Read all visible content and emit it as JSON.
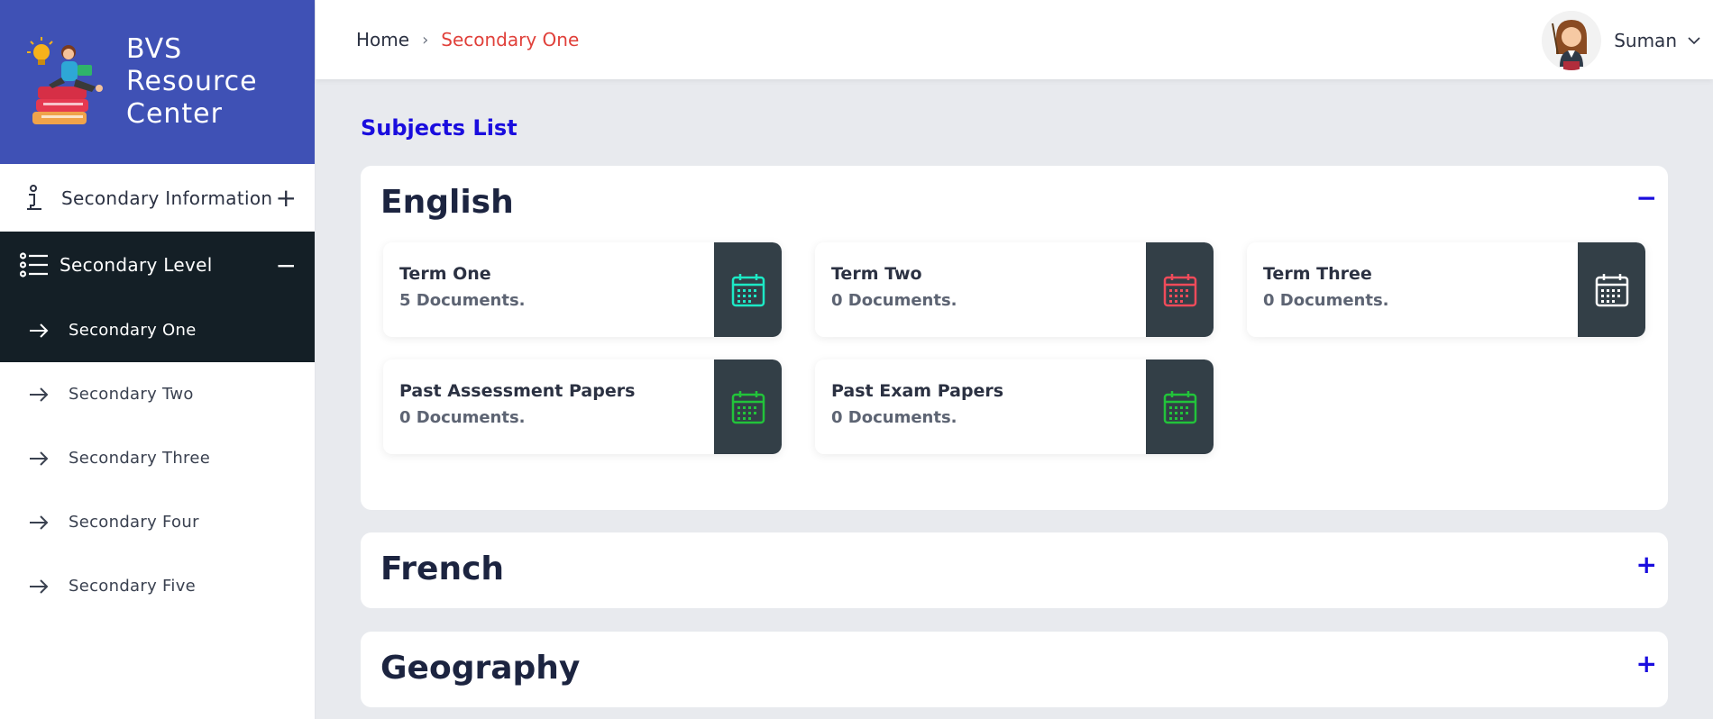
{
  "brand": {
    "title": "BVS Resource Center"
  },
  "sidebar": {
    "info": {
      "label": "Secondary Information",
      "toggle": "+"
    },
    "level": {
      "label": "Secondary Level",
      "toggle": "−"
    },
    "items": [
      {
        "label": "Secondary One",
        "active": true
      },
      {
        "label": "Secondary Two"
      },
      {
        "label": "Secondary Three"
      },
      {
        "label": "Secondary Four"
      },
      {
        "label": "Secondary Five"
      }
    ]
  },
  "header": {
    "breadcrumb": {
      "home": "Home",
      "separator": "›",
      "current": "Secondary One"
    },
    "user": {
      "name": "Suman"
    }
  },
  "main": {
    "title": "Subjects List",
    "subjects": [
      {
        "name": "English",
        "toggle": "−",
        "cards": [
          {
            "title": "Term One",
            "count": "5 Documents.",
            "icon_color": "#1de9c6"
          },
          {
            "title": "Term Two",
            "count": "0 Documents.",
            "icon_color": "#ef4b5a"
          },
          {
            "title": "Term Three",
            "count": "0 Documents.",
            "icon_color": "#ffffff"
          },
          {
            "title": "Past Assessment Papers",
            "count": "0 Documents.",
            "icon_color": "#22c33a"
          },
          {
            "title": "Past Exam Papers",
            "count": "0 Documents.",
            "icon_color": "#22c33a"
          }
        ]
      },
      {
        "name": "French",
        "toggle": "+"
      },
      {
        "name": "Geography",
        "toggle": "+"
      }
    ]
  },
  "colors": {
    "brand": "#3f51b5",
    "sidebar_active": "#141f26",
    "breadcrumb_current": "#e0403a",
    "accent": "#1a0dde",
    "card_icon_bg": "#333f47"
  }
}
